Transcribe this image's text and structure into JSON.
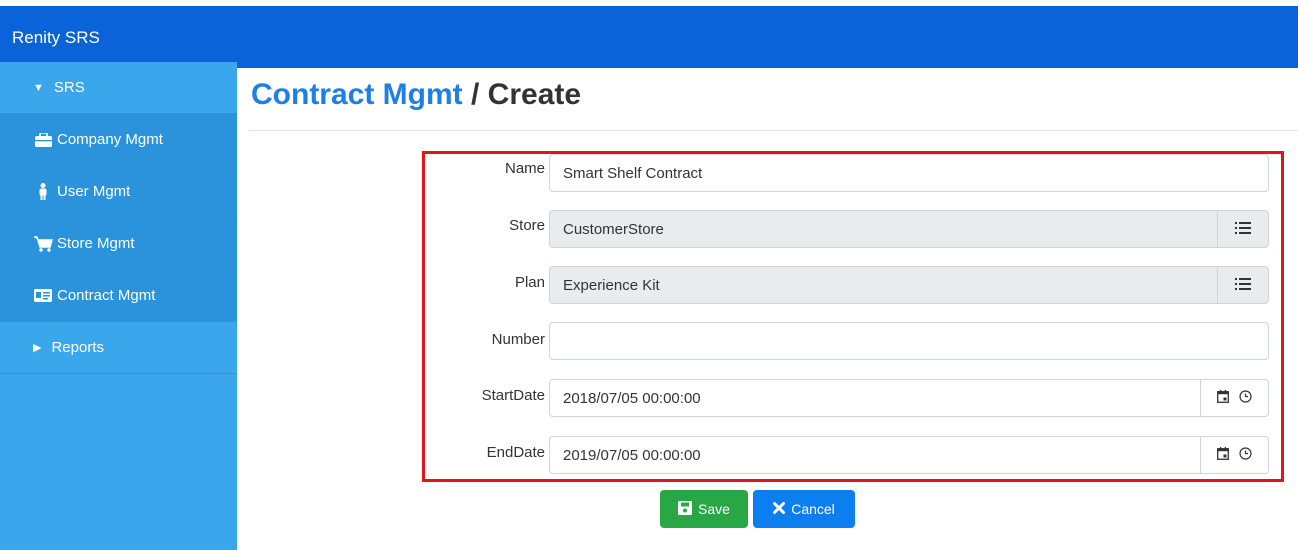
{
  "header": {
    "brand": "Renity SRS",
    "bg_color": "#0b63d9"
  },
  "sidebar": {
    "items": [
      {
        "label": "SRS",
        "icon": "caret-down-icon"
      },
      {
        "label": "Company Mgmt",
        "icon": "briefcase-icon"
      },
      {
        "label": "User Mgmt",
        "icon": "user-icon"
      },
      {
        "label": "Store Mgmt",
        "icon": "cart-icon"
      },
      {
        "label": "Contract Mgmt",
        "icon": "id-card-icon"
      },
      {
        "label": "Reports",
        "icon": "caret-right-icon"
      }
    ]
  },
  "page": {
    "title_link": "Contract Mgmt",
    "title_sep": " / ",
    "title_action": "Create"
  },
  "form": {
    "name": {
      "label": "Name",
      "value": "Smart Shelf Contract"
    },
    "store": {
      "label": "Store",
      "value": "CustomerStore"
    },
    "plan": {
      "label": "Plan",
      "value": "Experience Kit"
    },
    "number": {
      "label": "Number",
      "value": ""
    },
    "start": {
      "label": "StartDate",
      "value": "2018/07/05 00:00:00"
    },
    "end": {
      "label": "EndDate",
      "value": "2019/07/05 00:00:00"
    }
  },
  "actions": {
    "save": "Save",
    "cancel": "Cancel"
  },
  "colors": {
    "accent": "#1e7fe6",
    "save": "#28a745",
    "cancel": "#0b7ef0",
    "highlight_border": "#e3141c"
  }
}
